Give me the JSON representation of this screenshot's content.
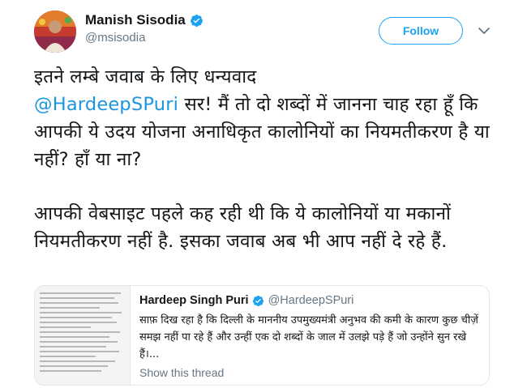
{
  "author": {
    "display_name": "Manish Sisodia",
    "handle": "@msisodia",
    "verified": true
  },
  "actions": {
    "follow_label": "Follow"
  },
  "tweet": {
    "para1_before_mention": "इतने लम्बे जवाब के लिए धन्यवाद",
    "mention": "@HardeepSPuri",
    "para1_after_mention": " सर! मैं तो दो शब्दों में जानना चाह रहा हूँ कि आपकी ये उदय योजना अनाधिकृत कालोनियों का नियमतीकरण है या नहीं? हाँ या ना?",
    "para2": "आपकी वेबसाइट पहले कह रही थी कि ये कालोनियों या मकानों नियमतीकरण नहीं है. इसका जवाब अब भी आप नहीं दे रहे हैं."
  },
  "quoted_tweet": {
    "display_name": "Hardeep Singh Puri",
    "handle": "@HardeepSPuri",
    "verified": true,
    "text": "साफ़ दिख रहा है कि दिल्ली के माननीय उपमुख्यमंत्री अनुभव की कमी के कारण कुछ चीज़ें समझ नहीं पा रहे हैं और उन्हीं एक दो शब्दों के जाल में उलझे पड़े हैं जो उन्होंने सुन रखे हैं।...",
    "show_thread_label": "Show this thread"
  },
  "colors": {
    "brand_blue": "#1da1f2",
    "mention_blue": "#1b95e0",
    "secondary_text": "#657786"
  },
  "icons": {
    "verified": "verified-badge-icon",
    "menu": "chevron-down-icon"
  }
}
